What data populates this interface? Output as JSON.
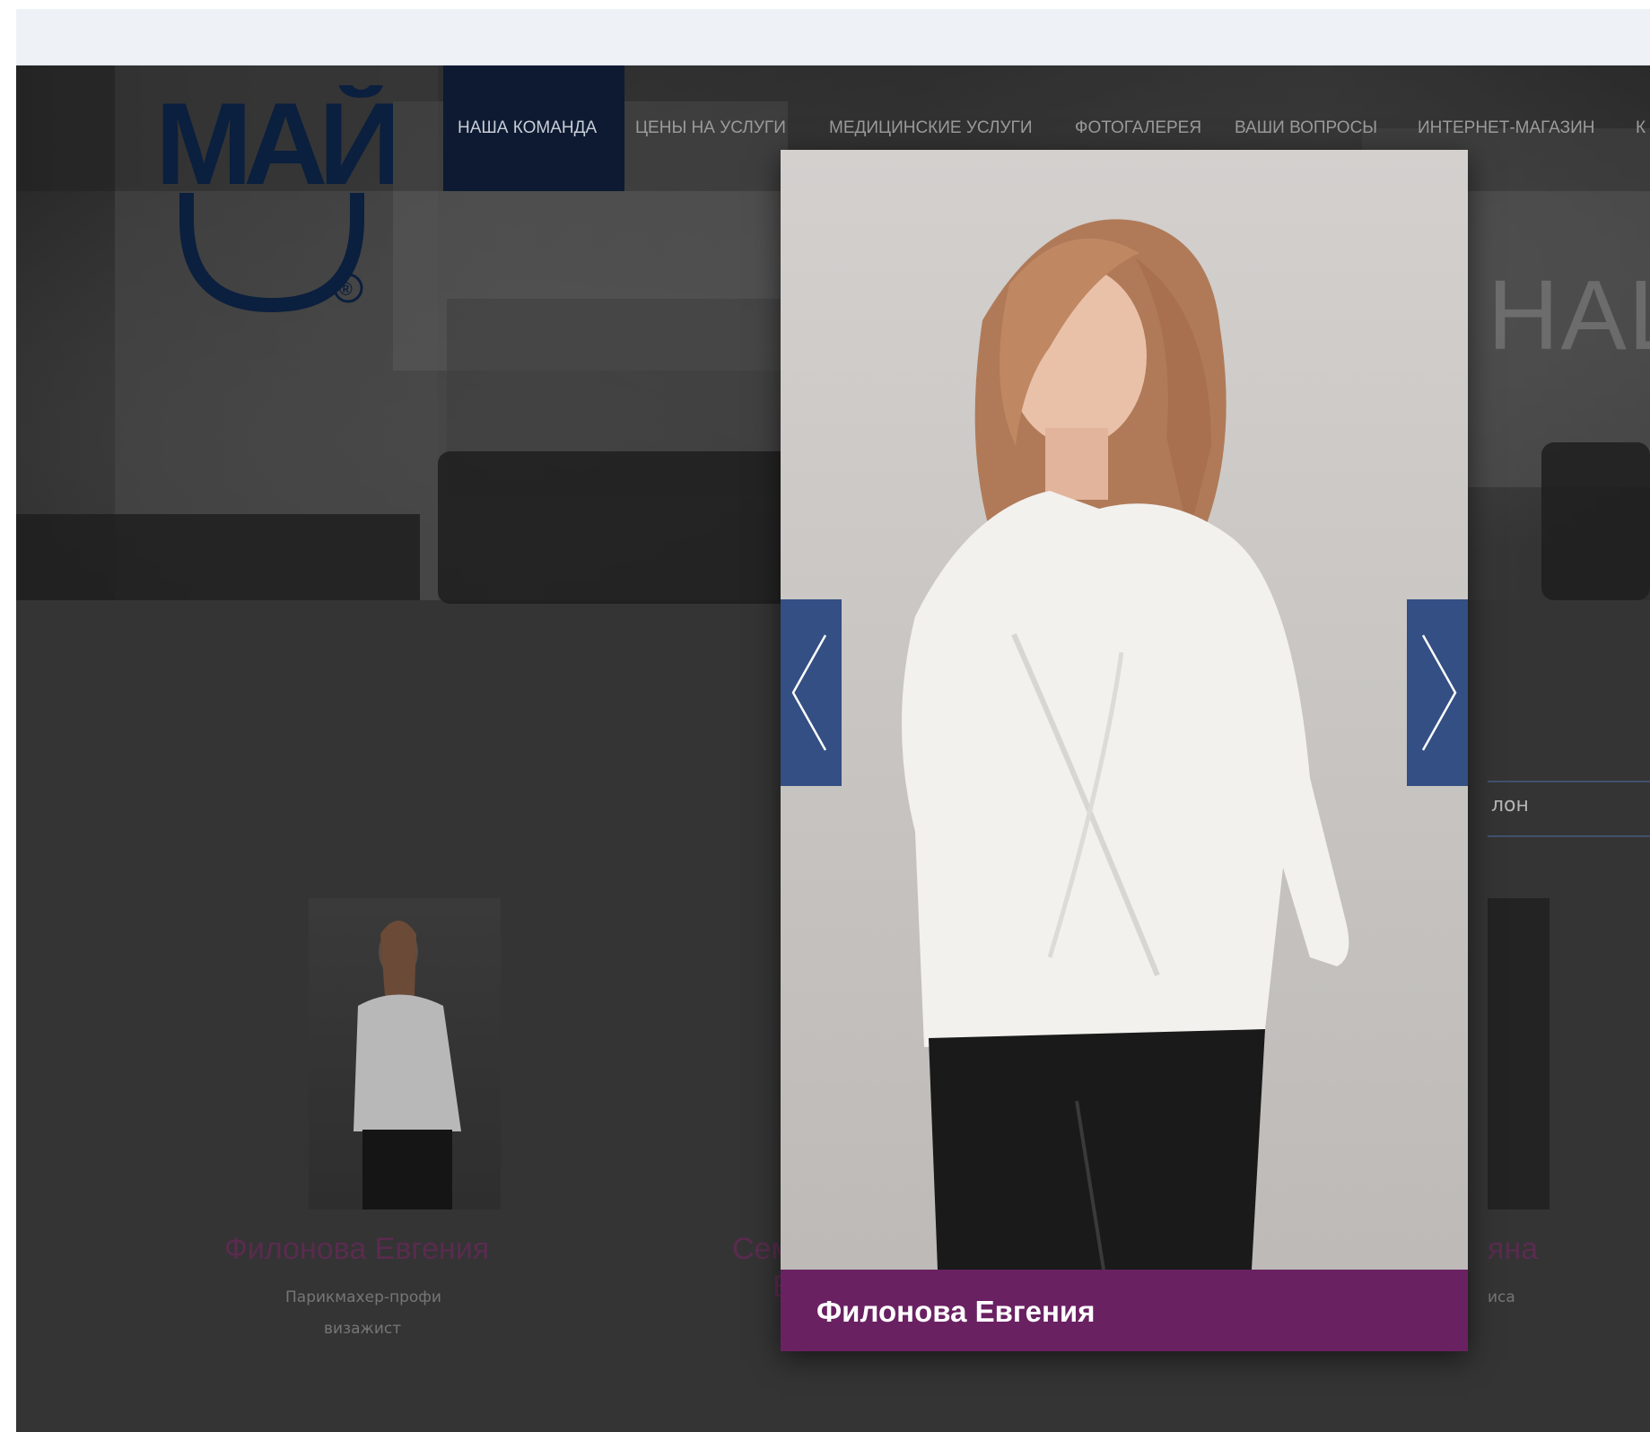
{
  "nav": {
    "items": [
      {
        "label": "НАША КОМАНДА",
        "active": true
      },
      {
        "label": "ЦЕНЫ НА УСЛУГИ"
      },
      {
        "label": "МЕДИЦИНСКИЕ УСЛУГИ"
      },
      {
        "label": "ФОТОГАЛЕРЕЯ"
      },
      {
        "label": "ВАШИ ВОПРОСЫ"
      },
      {
        "label": "ИНТЕРНЕТ-МАГАЗИН"
      },
      {
        "label": "К"
      }
    ]
  },
  "logo": {
    "text": "МАЙ",
    "registered": "®"
  },
  "hero": {
    "heading": "НАШ"
  },
  "subnav": {
    "text": "лон"
  },
  "team": [
    {
      "name": "Филонова Евгения",
      "roles": [
        "Парикмахер-профи",
        "визажист"
      ]
    },
    {
      "name": "Сем",
      "name_line2": "В"
    },
    {
      "name": "яна",
      "roles": [
        "иса"
      ]
    }
  ],
  "lightbox": {
    "caption": "Филонова Евгения",
    "prev_label": "previous",
    "next_label": "next"
  },
  "colors": {
    "accent_purple": "#6a2162",
    "arrow_blue": "#334f83",
    "nav_active": "#0d1a32"
  }
}
